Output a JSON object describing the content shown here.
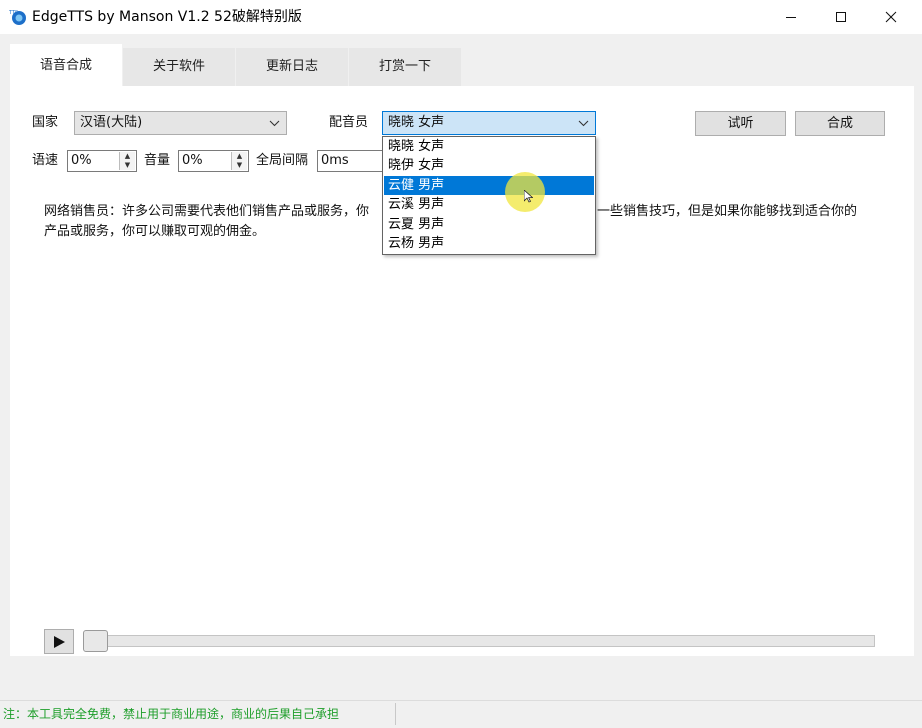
{
  "window": {
    "title": "EdgeTTS by Manson V1.2 52破解特别版",
    "icons": {
      "app": "edge-tts-app-icon",
      "minimize": "minimize-icon",
      "maximize": "maximize-icon",
      "close": "close-icon"
    }
  },
  "tabs": [
    {
      "label": "语音合成",
      "active": true
    },
    {
      "label": "关于软件",
      "active": false
    },
    {
      "label": "更新日志",
      "active": false
    },
    {
      "label": "打赏一下",
      "active": false
    }
  ],
  "form": {
    "country_label": "国家",
    "country_value": "汉语(大陆)",
    "voice_label": "配音员",
    "voice_value": "晓晓 女声",
    "voice_options": [
      "晓晓 女声",
      "晓伊 女声",
      "云健 男声",
      "云溪 男声",
      "云夏 男声",
      "云杨 男声"
    ],
    "voice_highlighted": "云健 男声",
    "rate_label": "语速",
    "rate_value": "0%",
    "volume_label": "音量",
    "volume_value": "0%",
    "gap_label": "全局间隔",
    "gap_value": "0ms",
    "preview_button": "试听",
    "synthesize_button": "合成",
    "dropdown_arrow_icon": "chevron-down-icon"
  },
  "text_area": {
    "line1_left": "网络销售员：许多公司需要代表他们销售产品或服务，你",
    "line1_right": "一些销售技巧，但是如果你能够找到适合你的",
    "line2": "产品或服务，你可以赚取可观的佣金。"
  },
  "player": {
    "play_icon": "play-icon",
    "progress": 0
  },
  "status": {
    "text": "注：本工具完全免费，禁止用于商业用途，商业的后果自己承担"
  },
  "colors": {
    "accent": "#0078d7",
    "status_text": "#1e9e2a",
    "active_combo": "#cce4f7"
  }
}
